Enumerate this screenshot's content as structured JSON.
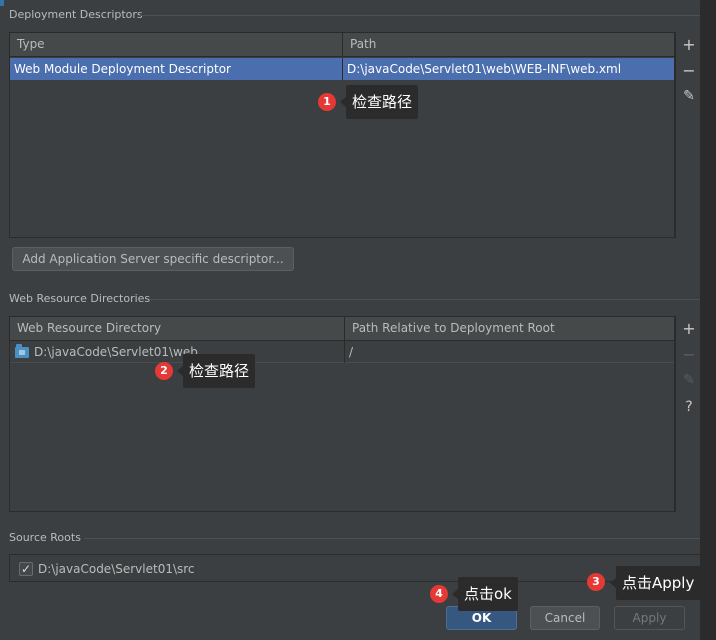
{
  "deployment": {
    "section_title": "Deployment Descriptors",
    "columns": [
      "Type",
      "Path"
    ],
    "rows": [
      {
        "type": "Web Module Deployment Descriptor",
        "path": "D:\\javaCode\\Servlet01\\web\\WEB-INF\\web.xml"
      }
    ],
    "add_button": "Add Application Server specific descriptor..."
  },
  "resources": {
    "section_title": "Web Resource Directories",
    "columns": [
      "Web Resource Directory",
      "Path Relative to Deployment Root"
    ],
    "rows": [
      {
        "dir": "D:\\javaCode\\Servlet01\\web",
        "rel": "/"
      }
    ]
  },
  "source_roots": {
    "section_title": "Source Roots",
    "items": [
      {
        "path": "D:\\javaCode\\Servlet01\\src",
        "checked": true
      }
    ]
  },
  "toolbar": {
    "add": "+",
    "remove": "−",
    "edit": "✎",
    "help": "?"
  },
  "buttons": {
    "ok": "OK",
    "cancel": "Cancel",
    "apply": "Apply"
  },
  "annotations": [
    {
      "num": "1",
      "text": "检查路径"
    },
    {
      "num": "2",
      "text": "检查路径"
    },
    {
      "num": "3",
      "text": "点击Apply"
    },
    {
      "num": "4",
      "text": "点击ok"
    }
  ],
  "colors": {
    "background": "#3c3f41",
    "selection": "#4b6eaf",
    "primary_button": "#365880",
    "badge": "#e53935"
  }
}
